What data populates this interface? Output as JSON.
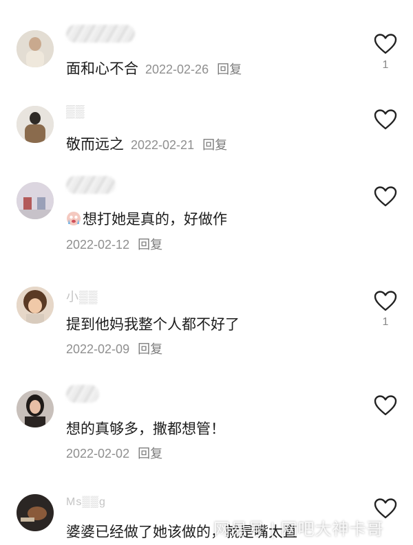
{
  "comments": [
    {
      "text": "面和心不合",
      "date": "2022-02-26",
      "reply": "回复",
      "likes": "1"
    },
    {
      "text": "敬而远之",
      "date": "2022-02-21",
      "reply": "回复",
      "likes": ""
    },
    {
      "text": "想打她是真的，好做作",
      "date": "2022-02-12",
      "reply": "回复",
      "likes": ""
    },
    {
      "username": "小▒▒",
      "text": "提到他妈我整个人都不好了",
      "date": "2022-02-09",
      "reply": "回复",
      "likes": "1"
    },
    {
      "text": "想的真够多，撒都想管！",
      "date": "2022-02-02",
      "reply": "回复",
      "likes": ""
    },
    {
      "username": "Ms▒▒g",
      "text": "婆婆已经做了她该做的，就是嘴太直",
      "date": "",
      "reply": "",
      "likes": ""
    }
  ],
  "watermark": "网易号 | 网吧大神卡哥",
  "colors": {
    "text": "#1c1c1c",
    "meta": "#8f8f8f",
    "heart": "#222222"
  },
  "icons": {
    "like": "heart-outline-icon",
    "emoji": "crying-face-emoji"
  }
}
